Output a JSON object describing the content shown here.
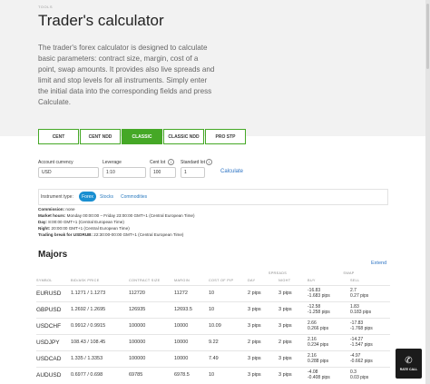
{
  "breadcrumb": "TOOLS",
  "title": "Trader's calculator",
  "intro": "The trader's forex calculator is designed to calculate basic parameters: contract size, margin, cost of a point, swap amounts. It provides also live spreads and limit and stop levels for all instruments. Simply enter the initial data into the corresponding fields and press Calculate.",
  "account_tabs": [
    "CENT",
    "CENT NDD",
    "CLASSIC",
    "CLASSIC NDD",
    "PRO STP"
  ],
  "active_tab": "CLASSIC",
  "form": {
    "currency_label": "Account currency",
    "currency_value": "USD",
    "leverage_label": "Leverage",
    "leverage_value": "1:10",
    "cent_lot_label": "Cent lot",
    "cent_lot_value": "100",
    "standard_lot_label": "Standard lot",
    "standard_lot_value": "1",
    "info_glyph": "i",
    "calculate_label": "Calculate"
  },
  "instrument_type": {
    "label": "Instrument type:",
    "active": "Forex",
    "others": [
      "Stocks",
      "Commodities"
    ]
  },
  "meta": {
    "commission_label": "Commission:",
    "commission_value": "none",
    "market_hours_label": "Market hours:",
    "market_hours_value": "Monday 00:00:00 – Friday 23:00:00 GMT+1 (Central European Time)",
    "day_label": "Day:",
    "day_value": "8:00:00 GMT+1 (Central European Time)",
    "night_label": "Night:",
    "night_value": "20:00:00 GMT+1 (Central European Time)",
    "trading_break_label": "Trading break for USDRUB:",
    "trading_break_value": "22:30:00-00:00 GMT+1 (Central European Time)"
  },
  "section_title": "Majors",
  "extend_label": "Extend",
  "table": {
    "group_headers": {
      "spreads": "SPREADS",
      "swap": "SWAP"
    },
    "columns": [
      "SYMBOL",
      "BID/ASK PRICE",
      "CONTRACT SIZE",
      "MARGIN",
      "COST OF PIP",
      "DAY",
      "NIGHT",
      "BUY",
      "SELL"
    ],
    "rows": [
      {
        "symbol": "EURUSD",
        "price": "1.1271 / 1.1273",
        "contract": "112720",
        "margin": "11272",
        "pip": "10",
        "day": "2 pips",
        "night": "3 pips",
        "buy": [
          "-16.83",
          "-1.683 pips"
        ],
        "sell": [
          "2.7",
          "0.27 pips"
        ]
      },
      {
        "symbol": "GBPUSD",
        "price": "1.2692 / 1.2695",
        "contract": "126935",
        "margin": "12693.5",
        "pip": "10",
        "day": "3 pips",
        "night": "3 pips",
        "buy": [
          "-12.58",
          "-1.258 pips"
        ],
        "sell": [
          "1.83",
          "0.183 pips"
        ]
      },
      {
        "symbol": "USDCHF",
        "price": "0.9912 / 0.9915",
        "contract": "100000",
        "margin": "10000",
        "pip": "10.09",
        "day": "3 pips",
        "night": "3 pips",
        "buy": [
          "2.66",
          "0.266 pips"
        ],
        "sell": [
          "-17.83",
          "-1.768 pips"
        ]
      },
      {
        "symbol": "USDJPY",
        "price": "108.43 / 108.45",
        "contract": "100000",
        "margin": "10000",
        "pip": "9.22",
        "day": "2 pips",
        "night": "2 pips",
        "buy": [
          "2.16",
          "0.234 pips"
        ],
        "sell": [
          "-14.27",
          "-1.547 pips"
        ]
      },
      {
        "symbol": "USDCAD",
        "price": "1.335 / 1.3353",
        "contract": "100000",
        "margin": "10000",
        "pip": "7.49",
        "day": "3 pips",
        "night": "3 pips",
        "buy": [
          "2.16",
          "0.288 pips"
        ],
        "sell": [
          "-4.97",
          "-0.662 pips"
        ]
      },
      {
        "symbol": "AUDUSD",
        "price": "0.6977 / 0.698",
        "contract": "69785",
        "margin": "6978.5",
        "pip": "10",
        "day": "3 pips",
        "night": "3 pips",
        "buy": [
          "-4.08",
          "-0.408 pips"
        ],
        "sell": [
          "0.3",
          "0.03 pips"
        ]
      }
    ]
  },
  "callback": {
    "icon": "phone-icon",
    "glyph": "✆",
    "label": "RATE CALL"
  },
  "colors": {
    "accent_green": "#45a826",
    "link_blue": "#2c73c4",
    "pill_blue": "#1a8fd1"
  }
}
